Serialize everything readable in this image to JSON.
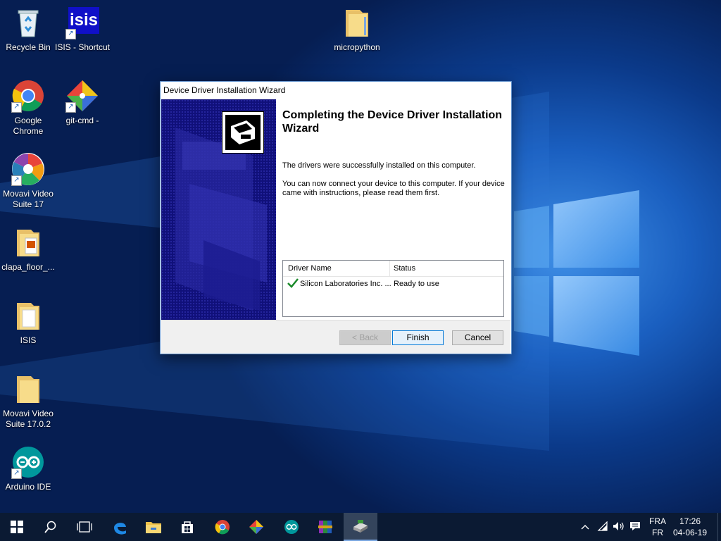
{
  "desktop": {
    "icons": [
      {
        "label": "Recycle Bin",
        "icon": "recycle-bin-icon"
      },
      {
        "label": "ISIS - Shortcut",
        "icon": "isis-icon"
      },
      {
        "label": "micropython",
        "icon": "folder-icon"
      },
      {
        "label": "Google Chrome",
        "icon": "chrome-icon"
      },
      {
        "label": "git-cmd -",
        "icon": "git-icon"
      },
      {
        "label": "Movavi Video Suite 17",
        "icon": "movavi-icon"
      },
      {
        "label": "clapa_floor_...",
        "icon": "folder-icon"
      },
      {
        "label": "ISIS",
        "icon": "folder-icon"
      },
      {
        "label": "Movavi Video Suite 17.0.2",
        "icon": "folder-icon"
      },
      {
        "label": "Arduino IDE",
        "icon": "arduino-icon"
      }
    ],
    "isis_logo_text": "isis"
  },
  "dialog": {
    "title": "Device Driver Installation Wizard",
    "heading": "Completing the Device Driver Installation Wizard",
    "message1": "The drivers were successfully installed on this computer.",
    "message2": "You can now connect your device to this computer. If your device came with instructions, please read them first.",
    "table": {
      "headers": [
        "Driver Name",
        "Status"
      ],
      "rows": [
        {
          "name": "Silicon Laboratories Inc. ...",
          "status": "Ready to use",
          "icon": "checkmark-icon"
        }
      ]
    },
    "buttons": {
      "back": "< Back",
      "finish": "Finish",
      "cancel": "Cancel"
    }
  },
  "taskbar": {
    "items": [
      "start-icon",
      "search-icon",
      "task-view-icon",
      "edge-icon",
      "file-explorer-icon",
      "store-icon",
      "chrome-icon",
      "git-icon",
      "arduino-icon",
      "winrar-icon",
      "driver-installer-icon"
    ],
    "language_top": "FRA",
    "language_bottom": "FR",
    "time": "17:26",
    "date": "04-06-19"
  },
  "colors": {
    "desktop_blue": "#1a5fc0",
    "sidebar_navy": "#10107a",
    "taskbar": "#0b1a33",
    "success_green": "#1a8a2a"
  }
}
